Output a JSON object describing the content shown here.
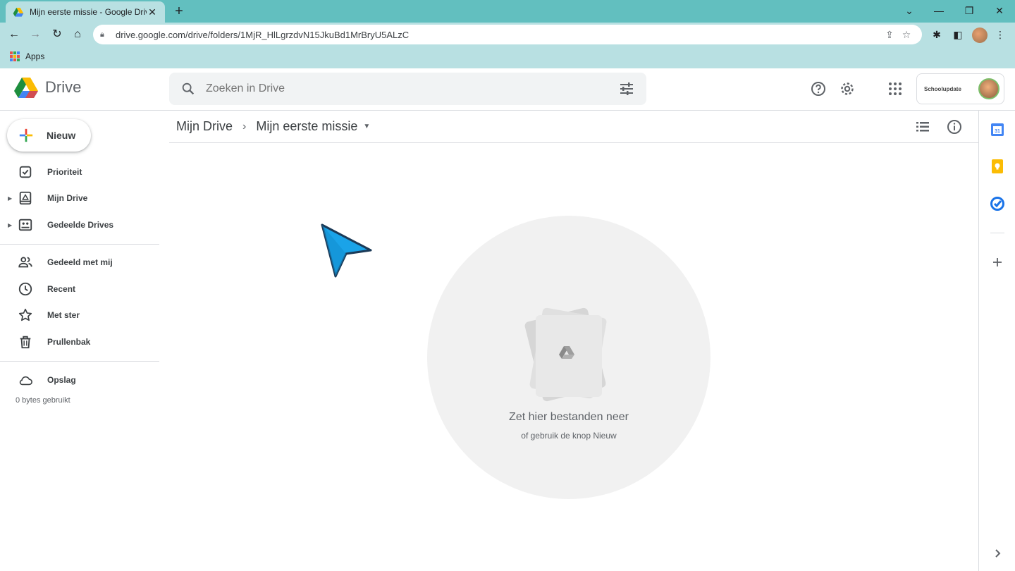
{
  "browser": {
    "tab_title": "Mijn eerste missie - Google Drive",
    "tab_close": "✕",
    "new_tab": "+",
    "url": "drive.google.com/drive/folders/1MjR_HlLgrzdvN15JkuBd1MrBryU5ALzC",
    "bookmark_apps": "Apps"
  },
  "header": {
    "product_name": "Drive",
    "search_placeholder": "Zoeken in Drive",
    "org_logo_text": "Schoolupdate"
  },
  "sidebar": {
    "new_label": "Nieuw",
    "items": [
      {
        "label": "Prioriteit",
        "icon": "priority-check-icon"
      },
      {
        "label": "Mijn Drive",
        "icon": "my-drive-icon"
      },
      {
        "label": "Gedeelde Drives",
        "icon": "shared-drives-icon"
      },
      {
        "label": "Gedeeld met mij",
        "icon": "people-icon"
      },
      {
        "label": "Recent",
        "icon": "clock-icon"
      },
      {
        "label": "Met ster",
        "icon": "star-icon"
      },
      {
        "label": "Prullenbak",
        "icon": "trash-icon"
      },
      {
        "label": "Opslag",
        "icon": "cloud-icon"
      }
    ],
    "storage_used": "0 bytes gebruikt"
  },
  "breadcrumb": {
    "root": "Mijn Drive",
    "current": "Mijn eerste missie"
  },
  "empty_state": {
    "title": "Zet hier bestanden neer",
    "subtitle": "of gebruik de knop Nieuw"
  },
  "colors": {
    "tabstrip": "#62bfbf",
    "toolbar": "#b8e0e2",
    "cursor": "#1aa3e8"
  }
}
